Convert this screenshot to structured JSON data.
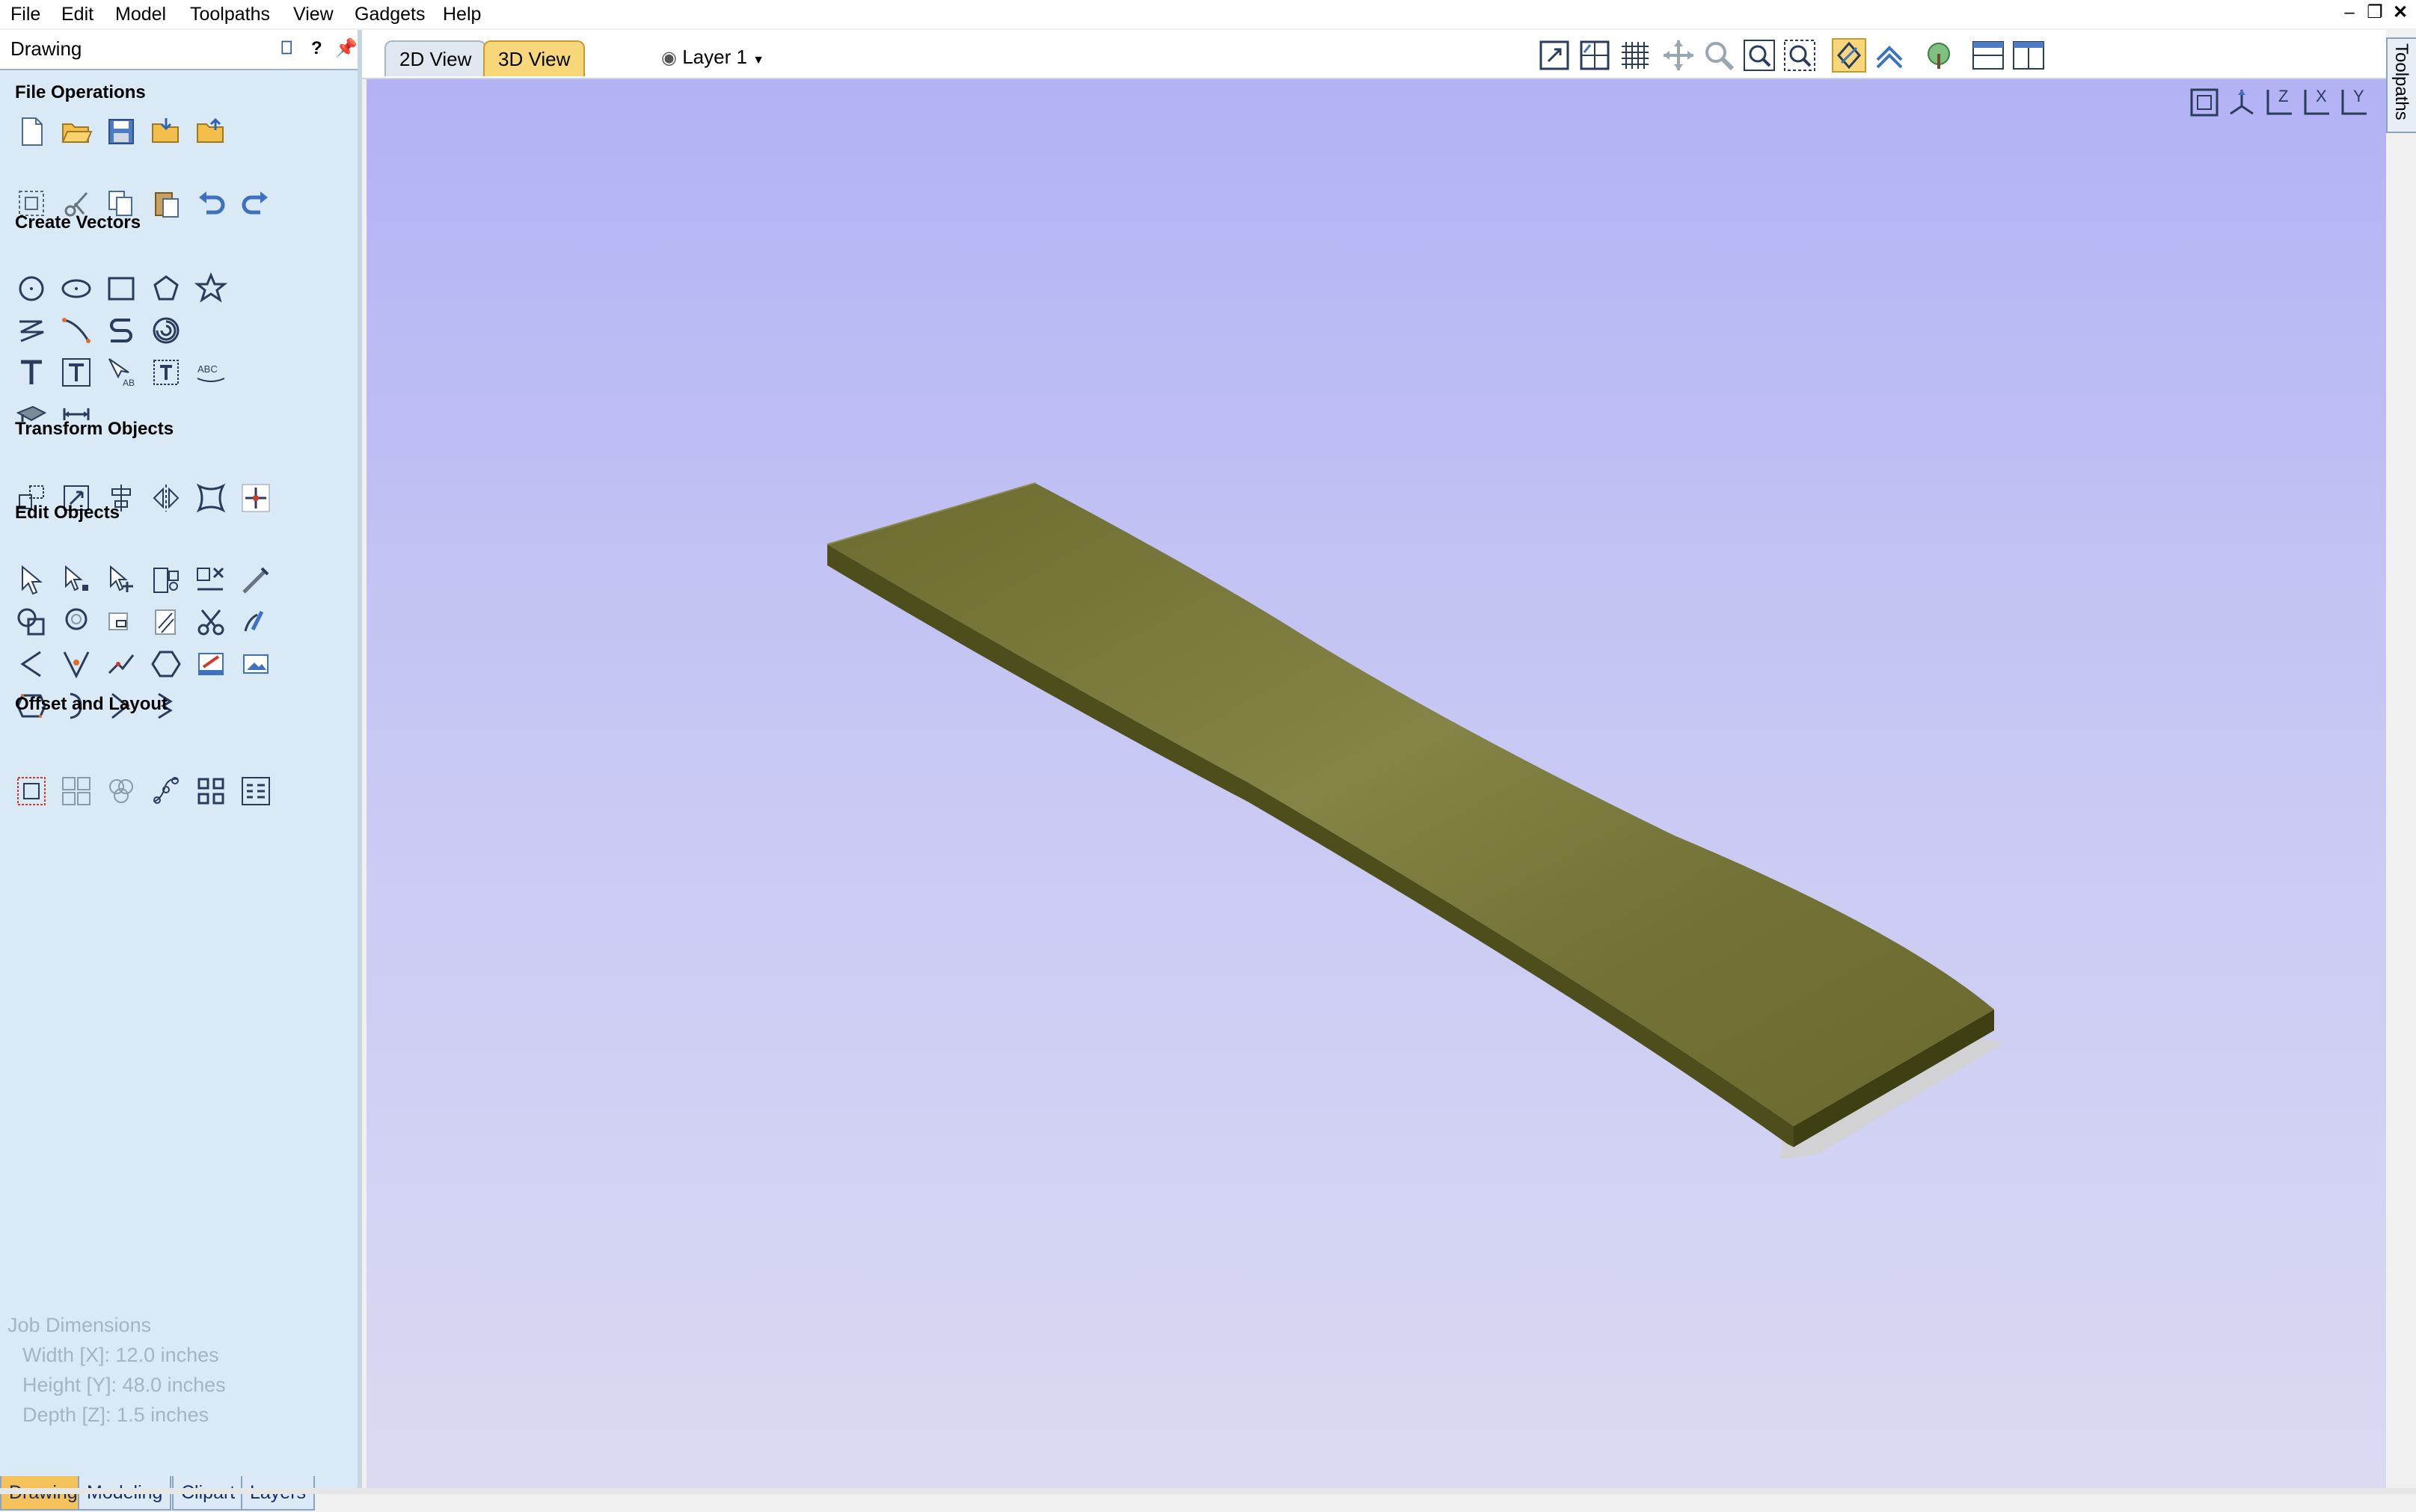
{
  "menu": [
    "File",
    "Edit",
    "Model",
    "Toolpaths",
    "View",
    "Gadgets",
    "Help"
  ],
  "panel": {
    "title": "Drawing",
    "sections": {
      "file_operations": "File Operations",
      "create_vectors": "Create Vectors",
      "transform_objects": "Transform Objects",
      "edit_objects": "Edit Objects",
      "offset_layout": "Offset and Layout"
    }
  },
  "job": {
    "heading": "Job Dimensions",
    "width": "Width  [X]: 12.0 inches",
    "height": "Height [Y]: 48.0 inches",
    "depth": "Depth  [Z]: 1.5 inches"
  },
  "bottom_tabs": [
    "Drawing",
    "Modeling",
    "Clipart",
    "Layers"
  ],
  "view_tabs": [
    "2D View",
    "3D View"
  ],
  "active_view_tab": "3D View",
  "layer": "Layer 1",
  "right_tab": "Toolpaths",
  "colors": {
    "panel_bg": "#d9eaf6",
    "active_tab": "#f5c25c",
    "model_top": "#7a7a3a",
    "model_side": "#55551f",
    "sky_top": "#b2b2f5",
    "sky_bottom": "#dadaf3"
  }
}
